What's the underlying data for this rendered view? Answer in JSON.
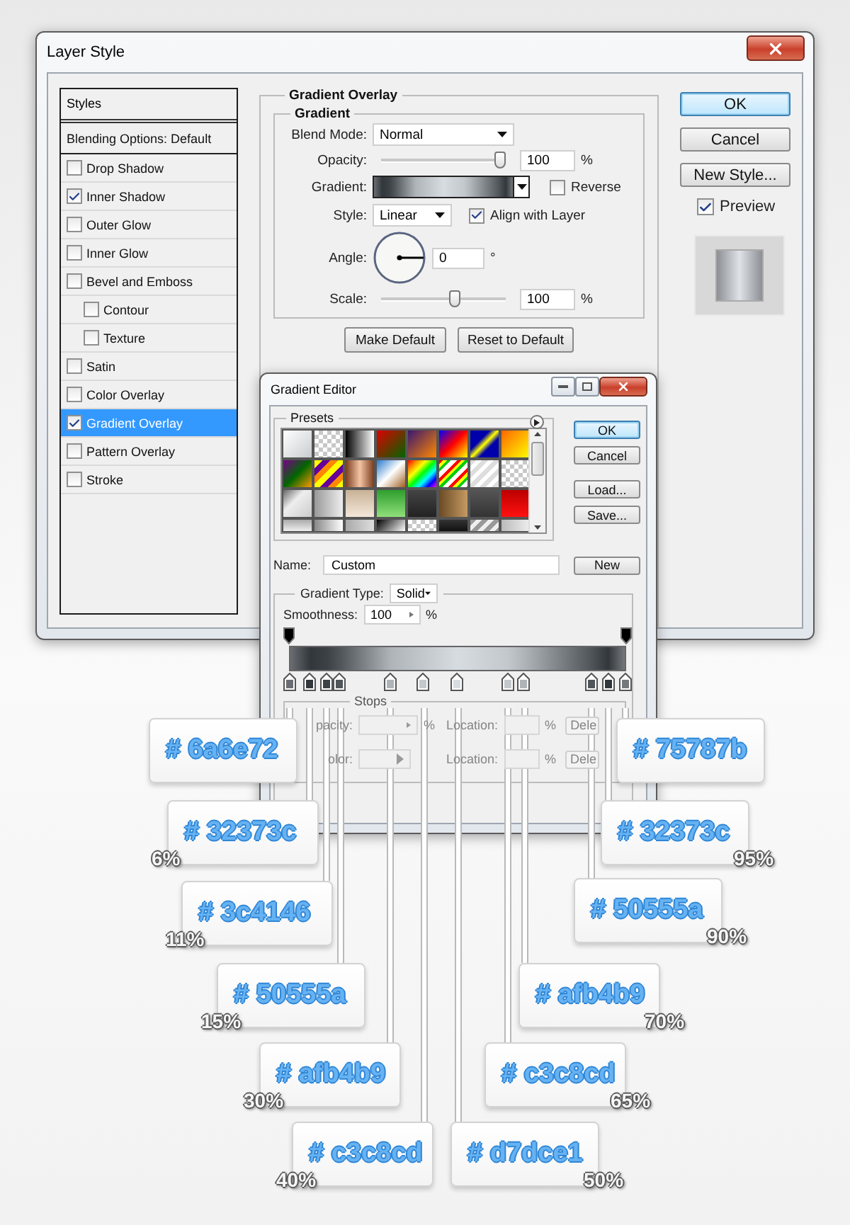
{
  "layer_style": {
    "title": "Layer Style",
    "styles": {
      "header": "Styles",
      "items": [
        {
          "label": "Blending Options: Default",
          "kind": "plain",
          "selected": false
        },
        {
          "label": "Drop Shadow",
          "kind": "check",
          "checked": false,
          "selected": false
        },
        {
          "label": "Inner Shadow",
          "kind": "check",
          "checked": true,
          "selected": false
        },
        {
          "label": "Outer Glow",
          "kind": "check",
          "checked": false,
          "selected": false
        },
        {
          "label": "Inner Glow",
          "kind": "check",
          "checked": false,
          "selected": false
        },
        {
          "label": "Bevel and Emboss",
          "kind": "check",
          "checked": false,
          "selected": false,
          "children": [
            {
              "label": "Contour",
              "kind": "check",
              "checked": false,
              "selected": false
            },
            {
              "label": "Texture",
              "kind": "check",
              "checked": false,
              "selected": false
            }
          ]
        },
        {
          "label": "Satin",
          "kind": "check",
          "checked": false,
          "selected": false
        },
        {
          "label": "Color Overlay",
          "kind": "check",
          "checked": false,
          "selected": false
        },
        {
          "label": "Gradient Overlay",
          "kind": "check",
          "checked": true,
          "selected": true
        },
        {
          "label": "Pattern Overlay",
          "kind": "check",
          "checked": false,
          "selected": false
        },
        {
          "label": "Stroke",
          "kind": "check",
          "checked": false,
          "selected": false
        }
      ]
    },
    "overlay": {
      "legend": "Gradient Overlay",
      "group": "Gradient",
      "blend_mode": {
        "label": "Blend Mode:",
        "value": "Normal"
      },
      "opacity": {
        "label": "Opacity:",
        "level": 1,
        "value": "100",
        "unit": "%"
      },
      "gradient": {
        "label": "Gradient:",
        "reverse": {
          "label": "Reverse",
          "checked": false
        }
      },
      "style": {
        "label": "Style:",
        "value": "Linear",
        "align": {
          "label": "Align with Layer",
          "checked": true
        }
      },
      "angle": {
        "label": "Angle:",
        "value": "0",
        "unit": "°"
      },
      "scale": {
        "label": "Scale:",
        "level": 0.6,
        "value": "100",
        "unit": "%"
      },
      "buttons": [
        "Make Default",
        "Reset to Default"
      ]
    },
    "actions": [
      {
        "label": "OK",
        "primary": true
      },
      {
        "label": "Cancel",
        "primary": false
      },
      {
        "label": "New Style...",
        "primary": false
      }
    ],
    "preview": {
      "label": "Preview",
      "checked": true
    }
  },
  "gradient_editor": {
    "title": "Gradient Editor",
    "presets_label": "Presets",
    "buttons": [
      {
        "label": "OK",
        "primary": true
      },
      {
        "label": "Cancel",
        "primary": false
      },
      {
        "label": "Load...",
        "primary": false
      },
      {
        "label": "Save...",
        "primary": false
      }
    ],
    "name": {
      "label": "Name:",
      "value": "Custom",
      "button": "New"
    },
    "gradient_type": {
      "label": "Gradient Type:",
      "value": "Solid"
    },
    "smoothness": {
      "label": "Smoothness:",
      "value": "100",
      "unit": "%"
    },
    "stops": {
      "label": "Stops",
      "disabled": true,
      "rows": [
        {
          "kind": "opacity",
          "label": "pacity:",
          "unit": "%",
          "location_label": "Location:",
          "location_unit": "%",
          "button": "Dele"
        },
        {
          "kind": "color",
          "label": "olor:",
          "location_label": "Location:",
          "location_unit": "%",
          "button": "Dele"
        }
      ]
    }
  },
  "callouts": [
    {
      "hex": "# 6a6e72"
    },
    {
      "hex": "# 75787b"
    },
    {
      "hex": "# 32373c",
      "percent": "6%"
    },
    {
      "hex": "# 32373c",
      "percent": "95%"
    },
    {
      "hex": "# 3c4146",
      "percent": "11%"
    },
    {
      "hex": "# 50555a",
      "percent": "90%"
    },
    {
      "hex": "# 50555a",
      "percent": "15%"
    },
    {
      "hex": "# afb4b9",
      "percent": "70%"
    },
    {
      "hex": "# afb4b9",
      "percent": "30%"
    },
    {
      "hex": "# c3c8cd",
      "percent": "65%"
    },
    {
      "hex": "# c3c8cd",
      "percent": "40%"
    },
    {
      "hex": "# d7dce1",
      "percent": "50%"
    }
  ]
}
